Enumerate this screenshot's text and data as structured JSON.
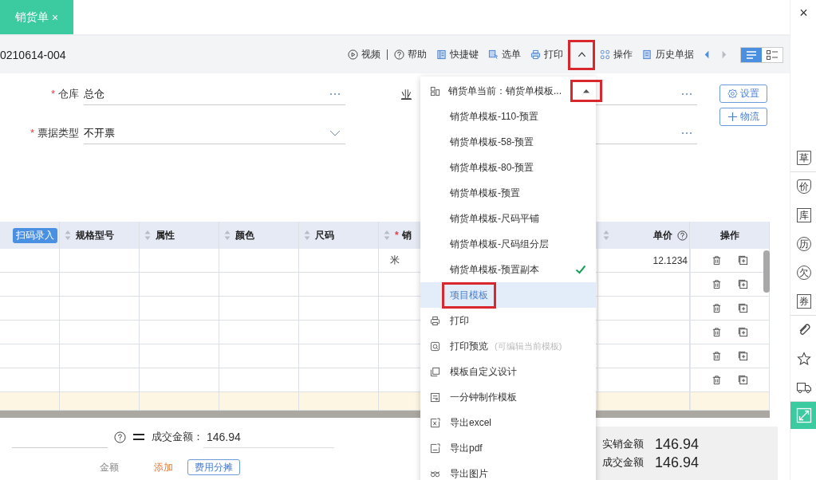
{
  "tab": {
    "label": "销货单",
    "close": "×"
  },
  "window_close": "×",
  "doc_number": "0210614-004",
  "toolbar": [
    {
      "kind": "video",
      "label": "视频"
    },
    {
      "kind": "help",
      "label": "帮助"
    },
    {
      "kind": "shortcut",
      "label": "快捷键"
    },
    {
      "kind": "pick",
      "label": "选单"
    },
    {
      "kind": "print",
      "label": "打印"
    },
    {
      "kind": "chevron",
      "marked": true
    },
    {
      "kind": "ops",
      "label": "操作"
    },
    {
      "kind": "history",
      "label": "历史单据"
    },
    {
      "kind": "prev"
    },
    {
      "kind": "next"
    }
  ],
  "view_toggle": [
    {
      "kind": "list",
      "selected": true
    },
    {
      "kind": "cards",
      "selected": false
    }
  ],
  "form": {
    "rows": [
      {
        "label": "仓库",
        "required_mark": "*",
        "value": "总仓",
        "kind": "more"
      },
      {
        "label": "票据类型",
        "required_mark": "*",
        "value": "不开票",
        "kind": "dropdown"
      }
    ],
    "cut_label": "业",
    "buttons": [
      {
        "kind": "settings",
        "label": "设置"
      },
      {
        "kind": "add",
        "label": "物流"
      }
    ]
  },
  "table": {
    "scan_button": "扫码录入",
    "columns": [
      {
        "label": "规格型号"
      },
      {
        "label": "属性"
      },
      {
        "label": "颜色"
      },
      {
        "label": "尺码"
      },
      {
        "label": "销",
        "required_mark": "*"
      }
    ],
    "price_column": "单价",
    "actions_column": "操作",
    "rows": [
      {
        "kind": "item",
        "unit": "米",
        "price": "12.1234"
      },
      {
        "kind": "item"
      },
      {
        "kind": "item"
      },
      {
        "kind": "item"
      },
      {
        "kind": "item"
      },
      {
        "kind": "item"
      },
      {
        "kind": "total"
      }
    ]
  },
  "summary": {
    "deal_label": "成交金额：",
    "deal_value": "146.94",
    "totals": [
      {
        "label": "实销金额",
        "value": "146.94"
      },
      {
        "label": "成交金额",
        "value": "146.94"
      }
    ],
    "amount_label": "金额",
    "add_label": "添加",
    "split_button": "费用分摊"
  },
  "menu": {
    "current": {
      "label": "销货单当前：销货单模板...",
      "caret_marked": true
    },
    "templates": [
      {
        "label": "销货单模板-110-预置",
        "checked": false,
        "selected": false,
        "marked": false
      },
      {
        "label": "销货单模板-58-预置",
        "checked": false,
        "selected": false,
        "marked": false
      },
      {
        "label": "销货单模板-80-预置",
        "checked": false,
        "selected": false,
        "marked": false
      },
      {
        "label": "销货单模板-预置",
        "checked": false,
        "selected": false,
        "marked": false
      },
      {
        "label": "销货单模板-尺码平铺",
        "checked": false,
        "selected": false,
        "marked": false
      },
      {
        "label": "销货单模板-尺码组分层",
        "checked": false,
        "selected": false,
        "marked": false
      },
      {
        "label": "销货单模板-预置副本",
        "checked": true,
        "selected": false,
        "marked": false
      },
      {
        "label": "项目模板",
        "checked": false,
        "selected": true,
        "marked": true
      }
    ],
    "actions": [
      {
        "kind": "print",
        "label": "打印"
      },
      {
        "kind": "preview",
        "label": "打印预览",
        "hint": "(可编辑当前模板)"
      },
      {
        "kind": "design",
        "label": "模板自定义设计"
      },
      {
        "kind": "quick",
        "label": "一分钟制作模板"
      },
      {
        "kind": "excel",
        "label": "导出excel"
      },
      {
        "kind": "pdf",
        "label": "导出pdf"
      },
      {
        "kind": "image",
        "label": "导出图片"
      }
    ]
  },
  "sidebar": [
    {
      "kind": "draft",
      "label": "草"
    },
    {
      "kind": "shield",
      "label": "价"
    },
    {
      "kind": "square",
      "label": "库"
    },
    {
      "kind": "circle",
      "label": "历"
    },
    {
      "kind": "circle",
      "label": "欠"
    },
    {
      "kind": "square",
      "label": "券"
    },
    {
      "kind": "clip"
    },
    {
      "kind": "star"
    },
    {
      "kind": "truck"
    },
    {
      "kind": "expand"
    }
  ]
}
